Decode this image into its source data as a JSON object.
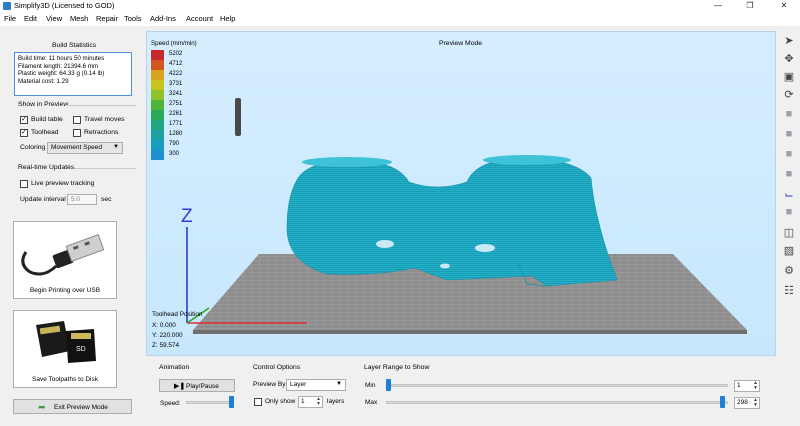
{
  "window": {
    "title": "Simplify3D (Licensed to GOD)"
  },
  "menu": [
    "File",
    "Edit",
    "View",
    "Mesh",
    "Repair",
    "Tools",
    "Add-Ins",
    "Account",
    "Help"
  ],
  "build_stats": {
    "title": "Build Statistics",
    "lines": [
      "Build time: 11 hours 50 minutes",
      "Filament length: 21394.6 mm",
      "Plastic weight: 64.33 g (0.14 lb)",
      "Material cost: 1.29"
    ]
  },
  "show_in_preview": {
    "title": "Show in Preview",
    "build_table": "Build table",
    "travel_moves": "Travel moves",
    "toolhead": "Toolhead",
    "retractions": "Retractions",
    "build_table_checked": true,
    "travel_moves_checked": false,
    "toolhead_checked": true,
    "retractions_checked": false,
    "coloring_label": "Coloring",
    "coloring_value": "Movement Speed"
  },
  "realtime": {
    "title": "Real-time Updates",
    "live_label": "Live preview tracking",
    "live_checked": false,
    "interval_label": "Update interval",
    "interval_value": "5.0",
    "interval_unit": "sec"
  },
  "buttons": {
    "usb": "Begin Printing over USB",
    "sd": "Save Toolpaths to Disk",
    "exit": "Exit Preview Mode"
  },
  "viewport": {
    "mode": "Preview Mode",
    "legend_title": "Speed (mm/min)",
    "legend_values": [
      "5202",
      "4712",
      "4222",
      "3731",
      "3241",
      "2751",
      "2261",
      "1771",
      "1280",
      "790",
      "300"
    ],
    "legend_colors": [
      "#c62a2a",
      "#d2561f",
      "#d9a41f",
      "#c9c41c",
      "#8fc12b",
      "#4fb53a",
      "#2aa95a",
      "#21a67f",
      "#1ea2a1",
      "#1a9cc0",
      "#1f8fd0"
    ],
    "axis_z_label": "Z",
    "toolhead_title": "Toolhead Position",
    "toolhead_x": "X: 0.000",
    "toolhead_y": "Y: 220.000",
    "toolhead_z": "Z: 59.574",
    "model_color": "#1fb0c8"
  },
  "animation": {
    "title": "Animation",
    "play_label": "Play/Pause",
    "speed_label": "Speed:",
    "speed_value": 1.0
  },
  "control_options": {
    "title": "Control Options",
    "preview_by_label": "Preview By",
    "preview_by_value": "Layer",
    "only_show_label": "Only show",
    "only_show_checked": false,
    "only_show_value": "1",
    "layers_label": "layers"
  },
  "layer_range": {
    "title": "Layer Range to Show",
    "min_label": "Min",
    "max_label": "Max",
    "min_value": "1",
    "max_value": "298"
  },
  "toolbar_icons": [
    "select-arrow-icon",
    "move-icon",
    "resize-icon",
    "rotate-icon",
    "view-cube-icon",
    "view-cube-front-icon",
    "view-cube-left-icon",
    "view-cube-right-icon",
    "axes-icon",
    "view-cube-solid-icon",
    "cross-section-icon",
    "separate-icon",
    "settings-icon",
    "support-icon"
  ]
}
